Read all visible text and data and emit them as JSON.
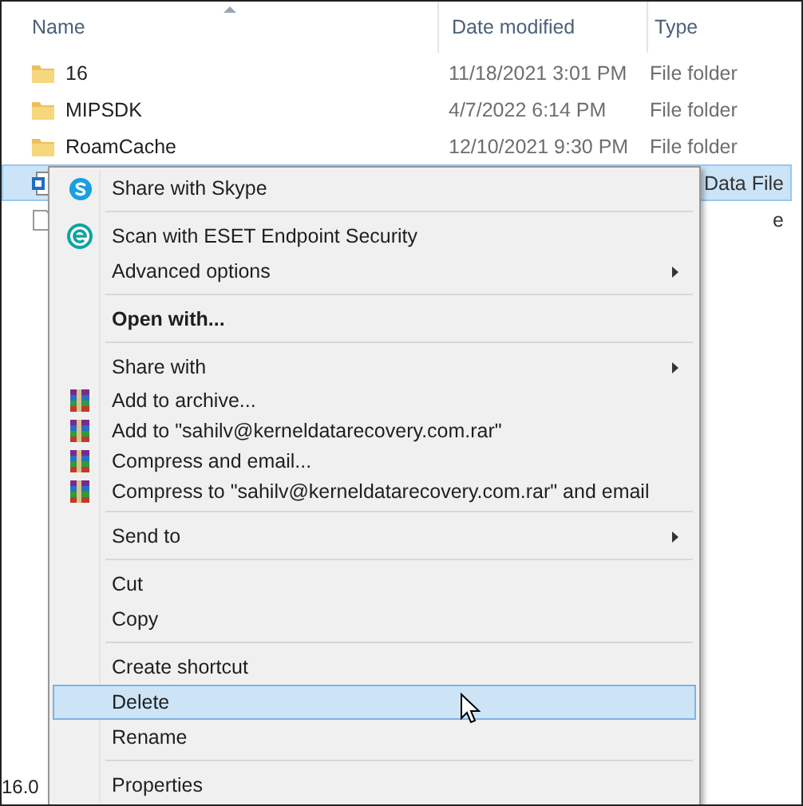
{
  "columns": [
    {
      "label": "Name"
    },
    {
      "label": "Date modified"
    },
    {
      "label": "Type"
    }
  ],
  "files": [
    {
      "name": "16",
      "date": "11/18/2021 3:01 PM",
      "type": "File folder"
    },
    {
      "name": "MIPSDK",
      "date": "4/7/2022 6:14 PM",
      "type": "File folder"
    },
    {
      "name": "RoamCache",
      "date": "12/10/2021 9:30 PM",
      "type": "File folder"
    }
  ],
  "covered_rows": [
    {
      "type": "Data File",
      "selected": true
    },
    {
      "type": "e",
      "selected": false
    }
  ],
  "status_bar": "16.0",
  "context_menu": [
    {
      "kind": "skype",
      "label": "Share with Skype",
      "bold": false,
      "submenu": false,
      "selected": false
    },
    {
      "kind": "separator"
    },
    {
      "kind": "eset",
      "label": "Scan with ESET Endpoint Security",
      "bold": false,
      "submenu": false,
      "selected": false
    },
    {
      "kind": "plain",
      "label": "Advanced options",
      "bold": false,
      "submenu": true,
      "selected": false
    },
    {
      "kind": "separator"
    },
    {
      "kind": "plain",
      "label": "Open with...",
      "bold": true,
      "submenu": false,
      "selected": false
    },
    {
      "kind": "separator"
    },
    {
      "kind": "plain",
      "label": "Share with",
      "bold": false,
      "submenu": true,
      "selected": false
    },
    {
      "kind": "archive",
      "label": "Add to archive...",
      "bold": false,
      "submenu": false,
      "selected": false
    },
    {
      "kind": "archive",
      "label": "Add to \"sahilv@kerneldatarecovery.com.rar\"",
      "bold": false,
      "submenu": false,
      "selected": false
    },
    {
      "kind": "archive",
      "label": "Compress and email...",
      "bold": false,
      "submenu": false,
      "selected": false
    },
    {
      "kind": "archive",
      "label": "Compress to \"sahilv@kerneldatarecovery.com.rar\" and email",
      "bold": false,
      "submenu": false,
      "selected": false
    },
    {
      "kind": "separator"
    },
    {
      "kind": "plain",
      "label": "Send to",
      "bold": false,
      "submenu": true,
      "selected": false
    },
    {
      "kind": "separator"
    },
    {
      "kind": "plain",
      "label": "Cut",
      "bold": false,
      "submenu": false,
      "selected": false
    },
    {
      "kind": "plain",
      "label": "Copy",
      "bold": false,
      "submenu": false,
      "selected": false
    },
    {
      "kind": "separator"
    },
    {
      "kind": "plain",
      "label": "Create shortcut",
      "bold": false,
      "submenu": false,
      "selected": false
    },
    {
      "kind": "plain",
      "label": "Delete",
      "bold": false,
      "submenu": false,
      "selected": true
    },
    {
      "kind": "plain",
      "label": "Rename",
      "bold": false,
      "submenu": false,
      "selected": false
    },
    {
      "kind": "separator"
    },
    {
      "kind": "plain",
      "label": "Properties",
      "bold": false,
      "submenu": false,
      "selected": false
    }
  ]
}
